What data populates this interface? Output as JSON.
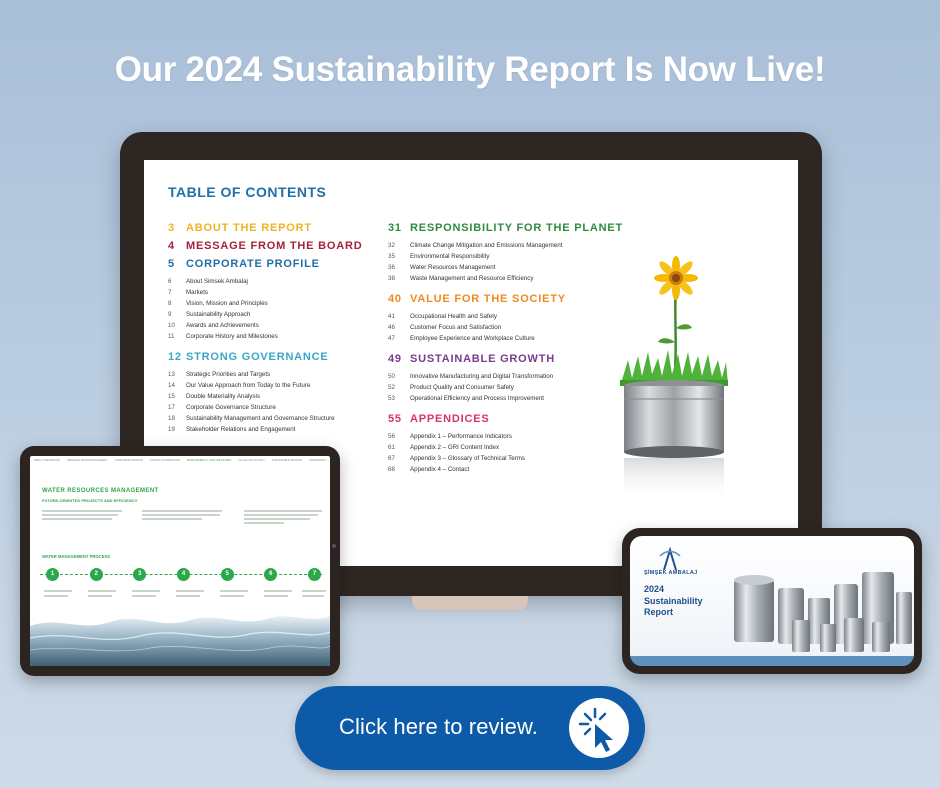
{
  "headline": "Our 2024 Sustainability Report Is Now Live!",
  "colors": {
    "background": "#b9cce0",
    "cta": "#0d5ba8",
    "toc_title": "#1f6fa8",
    "green_accent": "#2aa84a"
  },
  "monitor": {
    "toc_title": "TABLE OF CONTENTS",
    "left_sections": [
      {
        "num": "3",
        "title": "ABOUT THE REPORT",
        "color": "#f0b323",
        "items": []
      },
      {
        "num": "4",
        "title": "MESSAGE FROM THE BOARD",
        "color": "#a4213b",
        "items": []
      },
      {
        "num": "5",
        "title": "CORPORATE PROFILE",
        "color": "#1f6fa8",
        "items": [
          {
            "num": "6",
            "label": "About Simsek Ambalaj"
          },
          {
            "num": "7",
            "label": "Markets"
          },
          {
            "num": "8",
            "label": "Vision, Mission and Principles"
          },
          {
            "num": "9",
            "label": "Sustainability Approach"
          },
          {
            "num": "10",
            "label": "Awards and Achievements"
          },
          {
            "num": "11",
            "label": "Corporate History and Milestones"
          }
        ]
      },
      {
        "num": "12",
        "title": "STRONG GOVERNANCE",
        "color": "#3aa6c9",
        "items": [
          {
            "num": "13",
            "label": "Strategic Priorities and Targets"
          },
          {
            "num": "14",
            "label": "Our Value Approach from Today to the Future"
          },
          {
            "num": "15",
            "label": "Double Materiality Analysis"
          },
          {
            "num": "17",
            "label": "Corporate Governance Structure"
          },
          {
            "num": "18",
            "label": "Sustainability Management and Governance Structure"
          },
          {
            "num": "19",
            "label": "Stakeholder Relations and Engagement"
          }
        ]
      }
    ],
    "right_sections": [
      {
        "num": "31",
        "title": "RESPONSIBILITY FOR THE PLANET",
        "color": "#2e8b3e",
        "items": [
          {
            "num": "32",
            "label": "Climate Change Mitigation and Emissions Management"
          },
          {
            "num": "35",
            "label": "Environmental Responsibility"
          },
          {
            "num": "36",
            "label": "Water Resources Management"
          },
          {
            "num": "38",
            "label": "Waste Management and Resource Efficiency"
          }
        ]
      },
      {
        "num": "40",
        "title": "VALUE FOR THE SOCIETY",
        "color": "#ef8b1e",
        "items": [
          {
            "num": "41",
            "label": "Occupational Health and Safety"
          },
          {
            "num": "46",
            "label": "Customer Focus and Satisfaction"
          },
          {
            "num": "47",
            "label": "Employee Experience and Workplace Culture"
          }
        ]
      },
      {
        "num": "49",
        "title": "SUSTAINABLE GROWTH",
        "color": "#7a3a8e",
        "items": [
          {
            "num": "50",
            "label": "Innovative Manufacturing and Digital Transformation"
          },
          {
            "num": "52",
            "label": "Product Quality and Consumer Safety"
          },
          {
            "num": "53",
            "label": "Operational Efficiency and Process Improvement"
          }
        ]
      },
      {
        "num": "55",
        "title": "APPENDICES",
        "color": "#d6336c",
        "items": [
          {
            "num": "56",
            "label": "Appendix 1 – Performance Indicators"
          },
          {
            "num": "61",
            "label": "Appendix 2 – GRI Content Index"
          },
          {
            "num": "67",
            "label": "Appendix 3 – Glossary of Technical Terms"
          },
          {
            "num": "68",
            "label": "Appendix 4 – Contact"
          }
        ]
      }
    ]
  },
  "tablet": {
    "nav": [
      "ABOUT THE REPORT",
      "MESSAGE FROM MANAGEMENT",
      "CORPORATE PROFILE",
      "STRONG GOVERNANCE",
      "RESPONSIBILITY FOR THE PLANET",
      "VALUE FOR SOCIETY",
      "SUSTAINABLE GROWTH",
      "APPENDICES"
    ],
    "active_nav_index": 4,
    "title": "WATER RESOURCES MANAGEMENT",
    "subtitle": "FUTURE-ORIENTED PROJECTS AND EFFICIENCY",
    "process_title": "WATER MANAGEMENT PROCESS",
    "steps": [
      "1",
      "2",
      "3",
      "4",
      "5",
      "6",
      "7"
    ]
  },
  "phone": {
    "brand": "ŞİMŞEK AMBALAJ",
    "year": "2024",
    "title_line1": "Sustainability",
    "title_line2": "Report"
  },
  "cta": {
    "label": "Click here to review.",
    "icon": "cursor-click-icon"
  }
}
